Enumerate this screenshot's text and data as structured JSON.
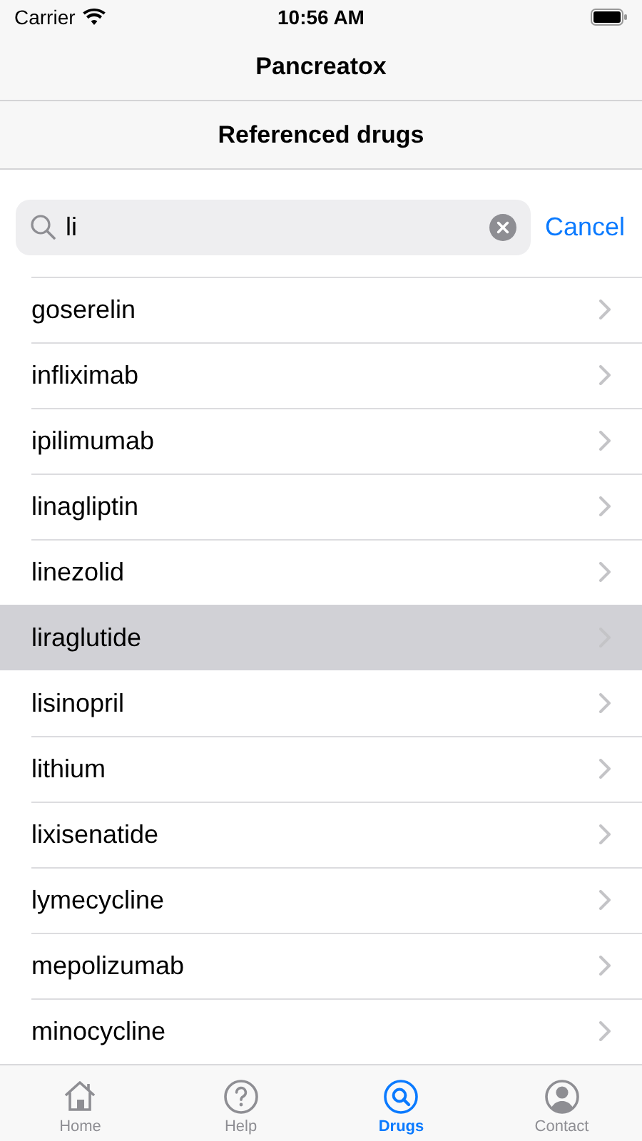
{
  "status_bar": {
    "carrier": "Carrier",
    "time": "10:56 AM"
  },
  "navigation": {
    "title": "Pancreatox",
    "subtitle": "Referenced drugs"
  },
  "search": {
    "value": "li",
    "cancel": "Cancel"
  },
  "drugs": [
    {
      "name": "goserelin",
      "selected": false
    },
    {
      "name": "infliximab",
      "selected": false
    },
    {
      "name": "ipilimumab",
      "selected": false
    },
    {
      "name": "linagliptin",
      "selected": false
    },
    {
      "name": "linezolid",
      "selected": false
    },
    {
      "name": "liraglutide",
      "selected": true
    },
    {
      "name": "lisinopril",
      "selected": false
    },
    {
      "name": "lithium",
      "selected": false
    },
    {
      "name": "lixisenatide",
      "selected": false
    },
    {
      "name": "lymecycline",
      "selected": false
    },
    {
      "name": "mepolizumab",
      "selected": false
    },
    {
      "name": "minocycline",
      "selected": false
    }
  ],
  "tab_bar": [
    {
      "kind": "home",
      "label": "Home",
      "selected": false
    },
    {
      "kind": "help",
      "label": "Help",
      "selected": false
    },
    {
      "kind": "drugs",
      "label": "Drugs",
      "selected": true
    },
    {
      "kind": "contact",
      "label": "Contact",
      "selected": false
    }
  ]
}
